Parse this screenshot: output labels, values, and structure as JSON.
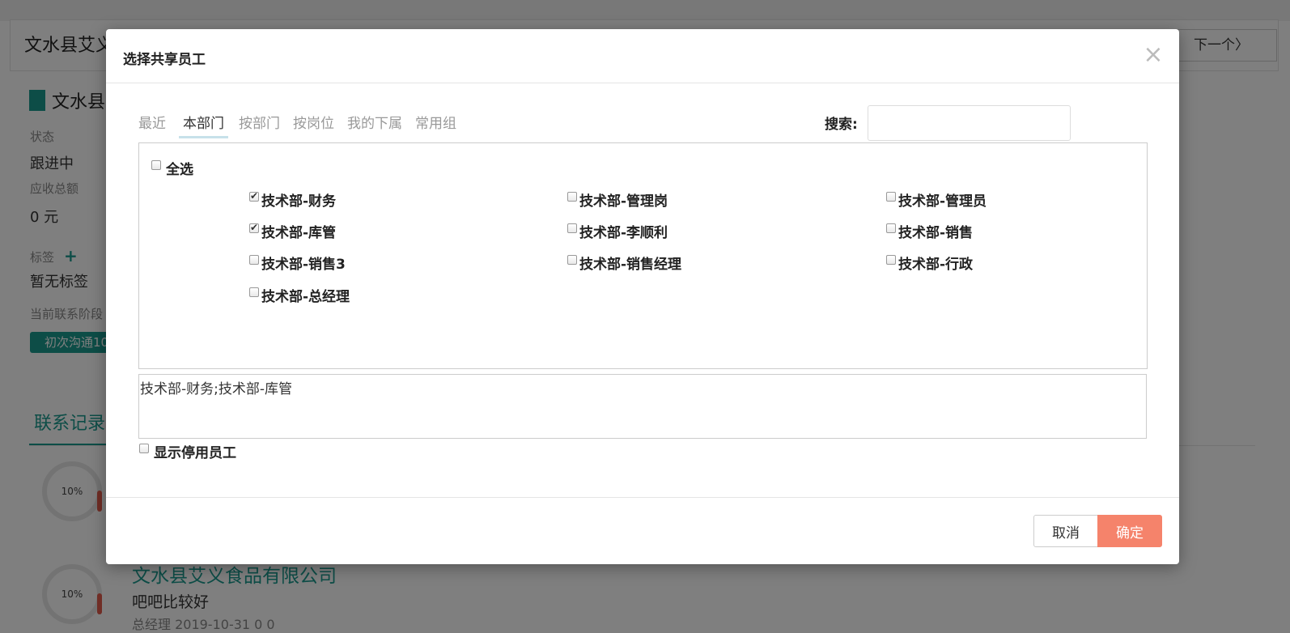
{
  "background": {
    "company_title": "文水县艾义",
    "next_button": "下一个〉",
    "company_name": "文水县",
    "status_label": "状态",
    "status_value": "跟进中",
    "receivable_label": "应收总额",
    "receivable_value": "0 元",
    "tags_label": "标签",
    "tags_value": "暂无标签",
    "stage_label": "当前联系阶段",
    "stage_badge": "初次沟通10",
    "records_tab": "联系记录",
    "records": [
      {
        "progress": "10%"
      },
      {
        "progress": "10%",
        "company": "文水县艾义食品有限公司",
        "text": "吧吧比较好",
        "meta": "总经理 2019-10-31  0  0"
      }
    ]
  },
  "modal": {
    "title": "选择共享员工",
    "close_glyph": "×",
    "tabs": [
      "最近",
      "本部门",
      "按部门",
      "按岗位",
      "我的下属",
      "常用组"
    ],
    "active_tab": "本部门",
    "search_label": "搜索:",
    "search_value": "",
    "select_all_label": "全选",
    "employees": [
      {
        "name": "技术部-财务",
        "checked": true
      },
      {
        "name": "技术部-管理岗",
        "checked": false
      },
      {
        "name": "技术部-管理员",
        "checked": false
      },
      {
        "name": "技术部-库管",
        "checked": true
      },
      {
        "name": "技术部-李顺利",
        "checked": false
      },
      {
        "name": "技术部-销售",
        "checked": false
      },
      {
        "name": "技术部-销售3",
        "checked": false
      },
      {
        "name": "技术部-销售经理",
        "checked": false
      },
      {
        "name": "技术部-行政",
        "checked": false
      },
      {
        "name": "技术部-总经理",
        "checked": false
      }
    ],
    "selected_text": "技术部-财务;技术部-库管",
    "show_disabled_label": "显示停用员工",
    "cancel_label": "取消",
    "confirm_label": "确定"
  }
}
